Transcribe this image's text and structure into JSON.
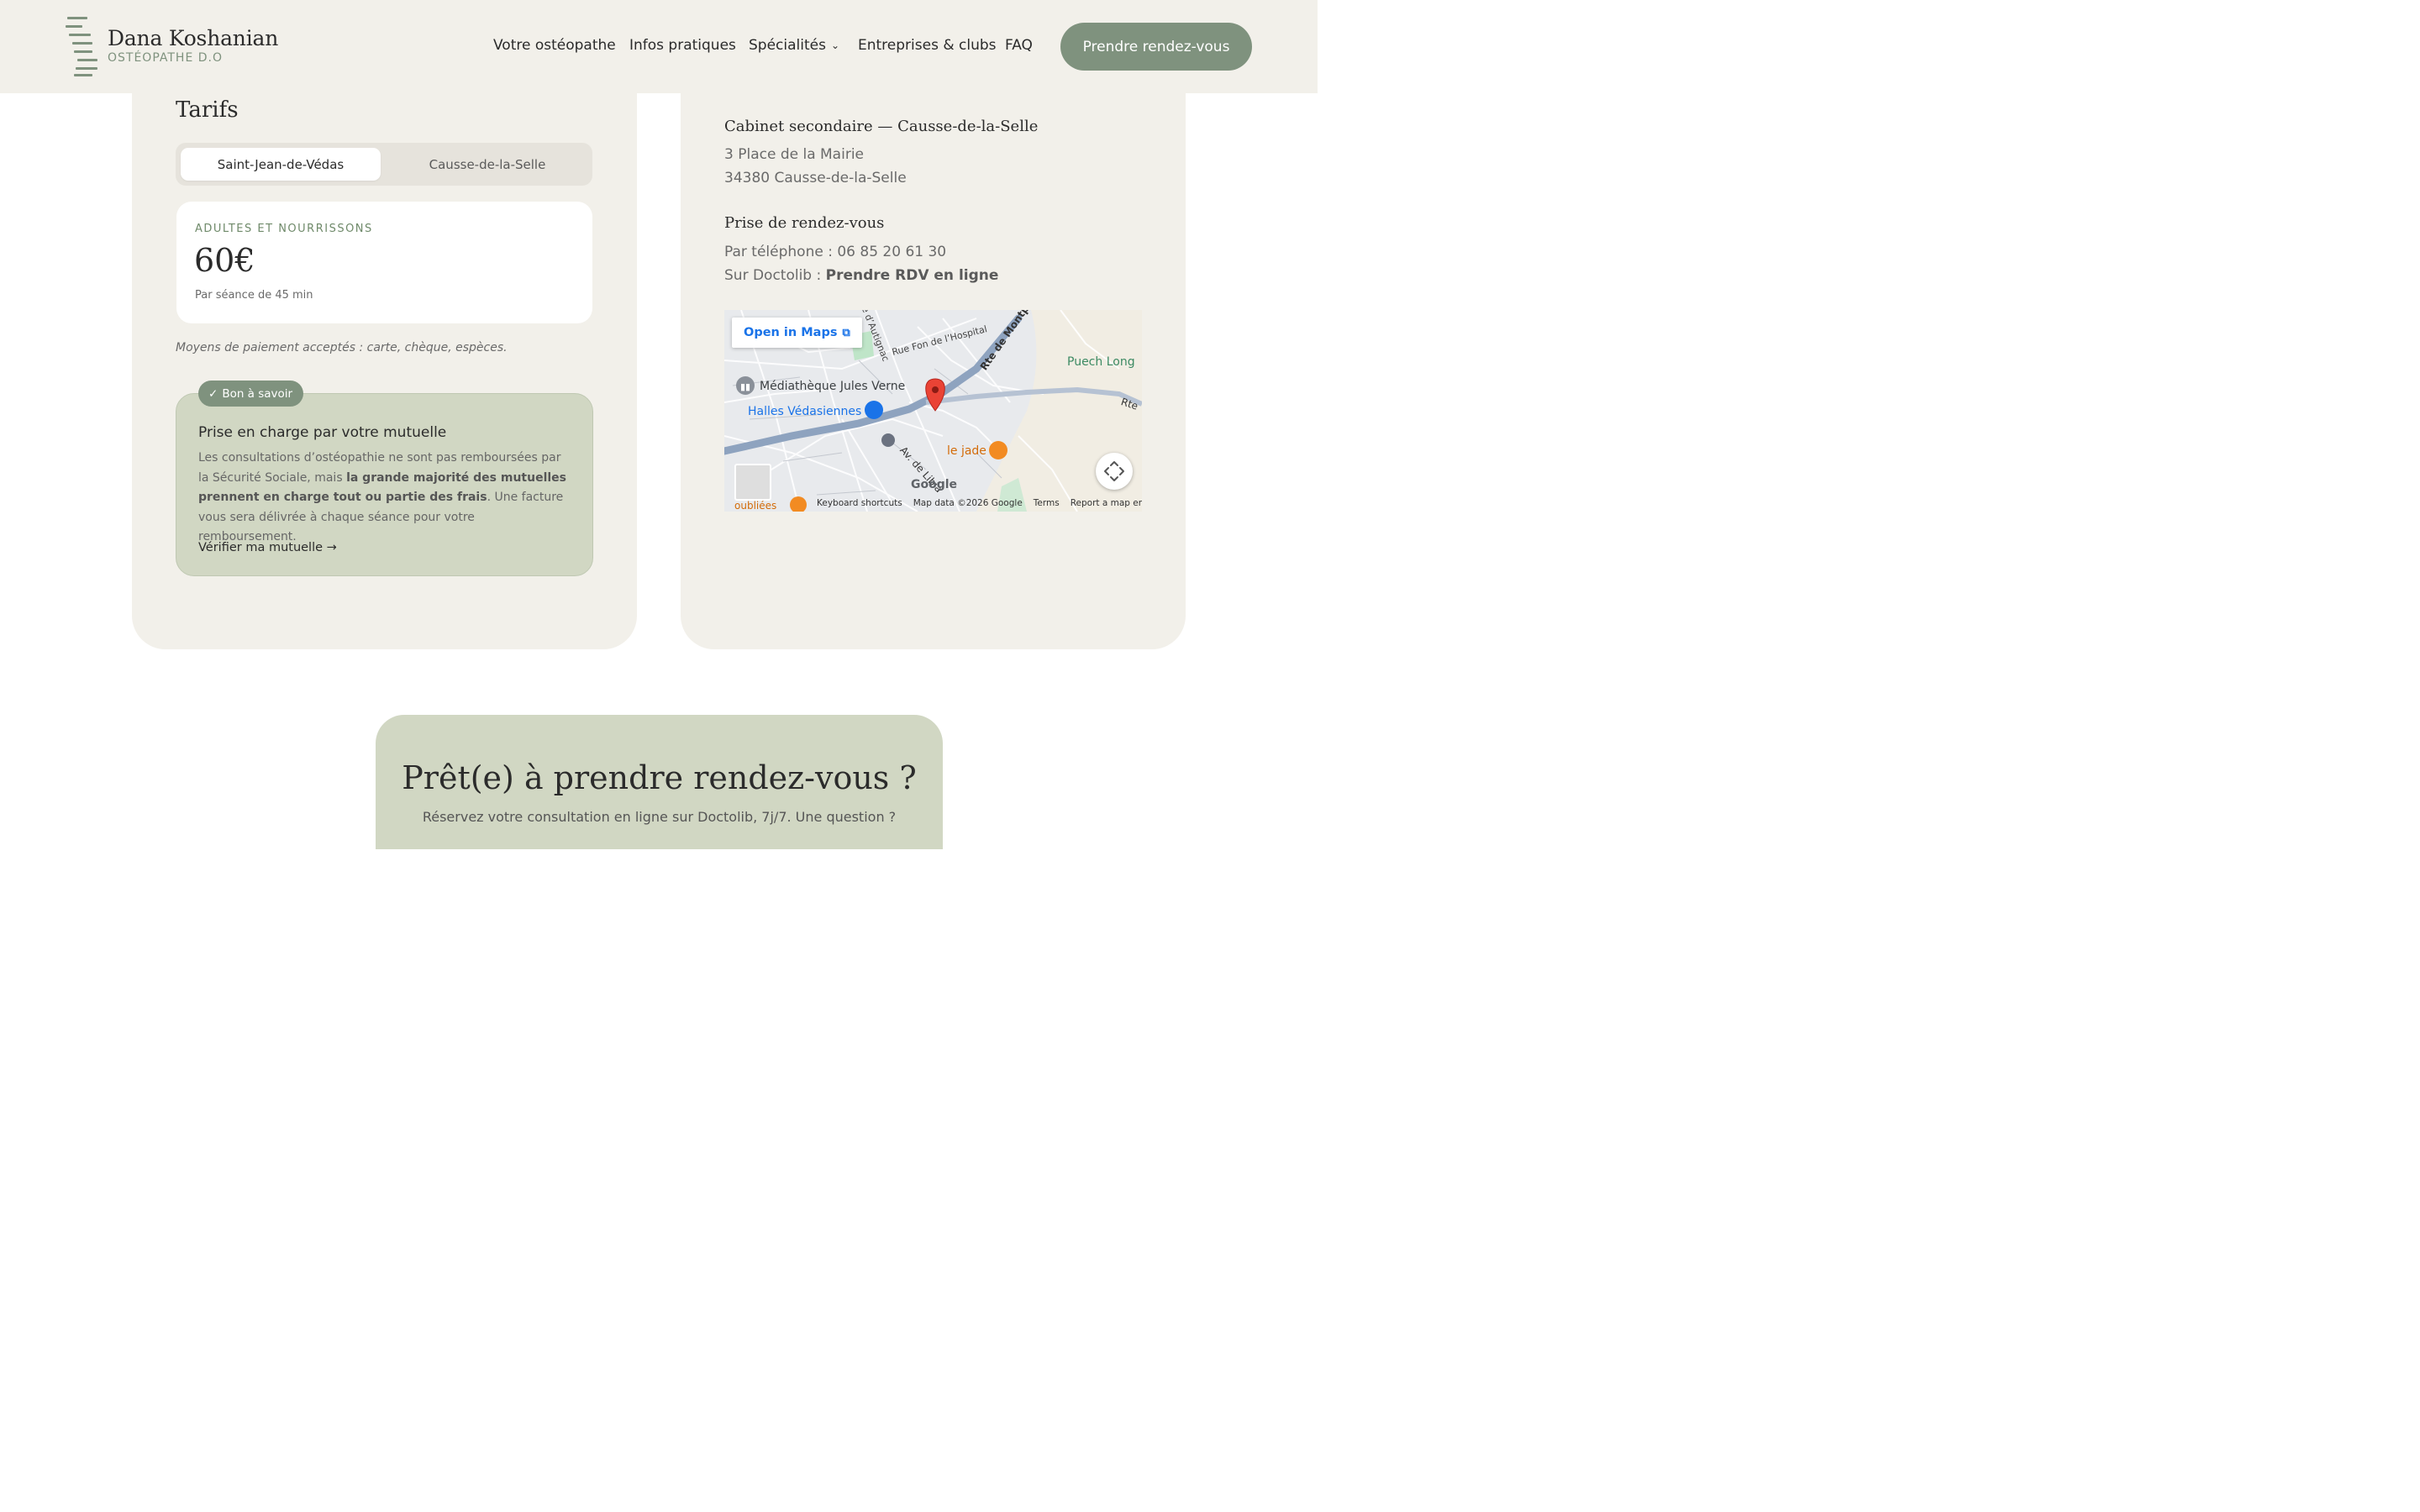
{
  "header": {
    "name": "Dana Koshanian",
    "subtitle": "OSTÉOPATHE D.O",
    "nav": [
      "Votre ostéopathe",
      "Infos pratiques",
      "Spécialités",
      "Entreprises & clubs",
      "FAQ"
    ],
    "cta": "Prendre rendez-vous"
  },
  "tarifs": {
    "title": "Tarifs",
    "tabs": [
      "Saint-Jean-de-Védas",
      "Causse-de-la-Selle"
    ],
    "active_tab": "Saint-Jean-de-Védas",
    "price_label": "ADULTES ET NOURRISSONS",
    "price": "60€",
    "price_note": "Par séance de 45 min",
    "payment": "Moyens de paiement acceptés : carte, chèque, espèces."
  },
  "info": {
    "badge": "Bon à savoir",
    "title": "Prise en charge par votre mutuelle",
    "text_1": "Les consultations d’ostéopathie ne sont pas remboursées par la Sécurité Sociale, mais ",
    "text_bold": "la grande majorité des mutuelles prennent en charge tout ou partie des frais",
    "text_2": ". Une facture vous sera délivrée à chaque séance pour votre remboursement.",
    "link": "Vérifier ma mutuelle →"
  },
  "cabinet": {
    "title": "Cabinet secondaire — Causse-de-la-Selle",
    "address_1": "3 Place de la Mairie",
    "address_2": "34380 Causse-de-la-Selle"
  },
  "rdv": {
    "title": "Prise de rendez-vous",
    "phone": "Par téléphone : 06 85 20 61 30",
    "doctolib_prefix": "Sur Doctolib : ",
    "doctolib_link": "Prendre RDV en ligne"
  },
  "map": {
    "open_label": "Open in Maps",
    "labels": {
      "mediatheque": "Médiathèque Jules Verne",
      "halles": "Halles Védasiennes",
      "puech": "Puech Long",
      "jade": "le jade",
      "rue_fon": "Rue Fon de l’Hospital",
      "rte_montp": "Rte de Montp",
      "aut": "e d’Autignac",
      "libia": "Av. de Libia",
      "rte": "Rte",
      "oubliees": "oubliées",
      "google": "Google"
    },
    "footer": [
      "Keyboard shortcuts",
      "Map data ©2026 Google",
      "Terms",
      "Report a map error"
    ]
  },
  "bottom_cta": {
    "title": "Prêt(e) à prendre rendez-vous ?",
    "subtitle": "Réservez votre consultation en ligne sur Doctolib, 7j/7. Une question ?"
  }
}
